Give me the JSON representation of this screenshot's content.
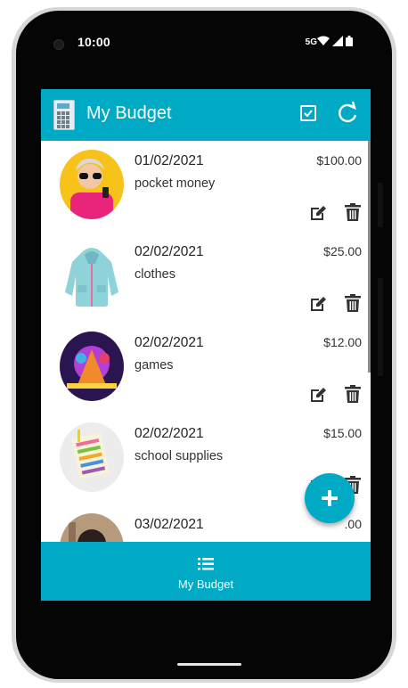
{
  "status_bar": {
    "time": "10:00",
    "network": "5G"
  },
  "app_bar": {
    "title": "My Budget",
    "icons": [
      "calculator-icon",
      "check-box-icon",
      "refresh-icon"
    ]
  },
  "items": [
    {
      "date": "01/02/2021",
      "description": "pocket money",
      "amount": "$100.00",
      "image": "woman-with-phone"
    },
    {
      "date": "02/02/2021",
      "description": "clothes",
      "amount": "$25.00",
      "image": "blue-hoodie"
    },
    {
      "date": "02/02/2021",
      "description": "games",
      "amount": "$12.00",
      "image": "game-art"
    },
    {
      "date": "02/02/2021",
      "description": "school supplies",
      "amount": "$15.00",
      "image": "notebook-pencils"
    },
    {
      "date": "03/02/2021",
      "description": "",
      "amount": ".00",
      "image": "portrait"
    }
  ],
  "fab": {
    "icon": "plus-icon"
  },
  "bottom_nav": {
    "label": "My Budget",
    "icon": "list-icon"
  },
  "colors": {
    "primary": "#00a9c4",
    "background": "#ffffff",
    "text": "#222222"
  }
}
